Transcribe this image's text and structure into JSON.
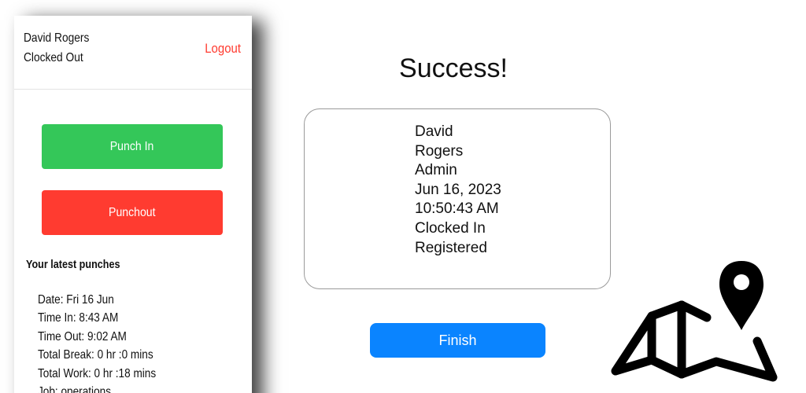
{
  "phone": {
    "user_name": "David Rogers",
    "user_status": "Clocked Out",
    "logout_label": "Logout",
    "punch_in_label": "Punch In",
    "punch_out_label": "Punchout",
    "latest_punches_title": "Your latest punches",
    "latest_punch": [
      "Date: Fri 16 Jun",
      "Time In: 8:43 AM",
      "Time Out: 9:02 AM",
      "Total Break: 0 hr :0 mins",
      "Total Work: 0 hr :18 mins",
      "Job: operations"
    ]
  },
  "success": {
    "title": "Success!",
    "details": [
      "David",
      "Rogers",
      "Admin",
      "Jun 16, 2023",
      "10:50:43 AM",
      "Clocked In",
      "Registered"
    ],
    "finish_label": "Finish"
  },
  "icons": {
    "map": "map-location-icon"
  },
  "colors": {
    "green": "#34c759",
    "red": "#ff3b30",
    "blue": "#0a84ff"
  }
}
